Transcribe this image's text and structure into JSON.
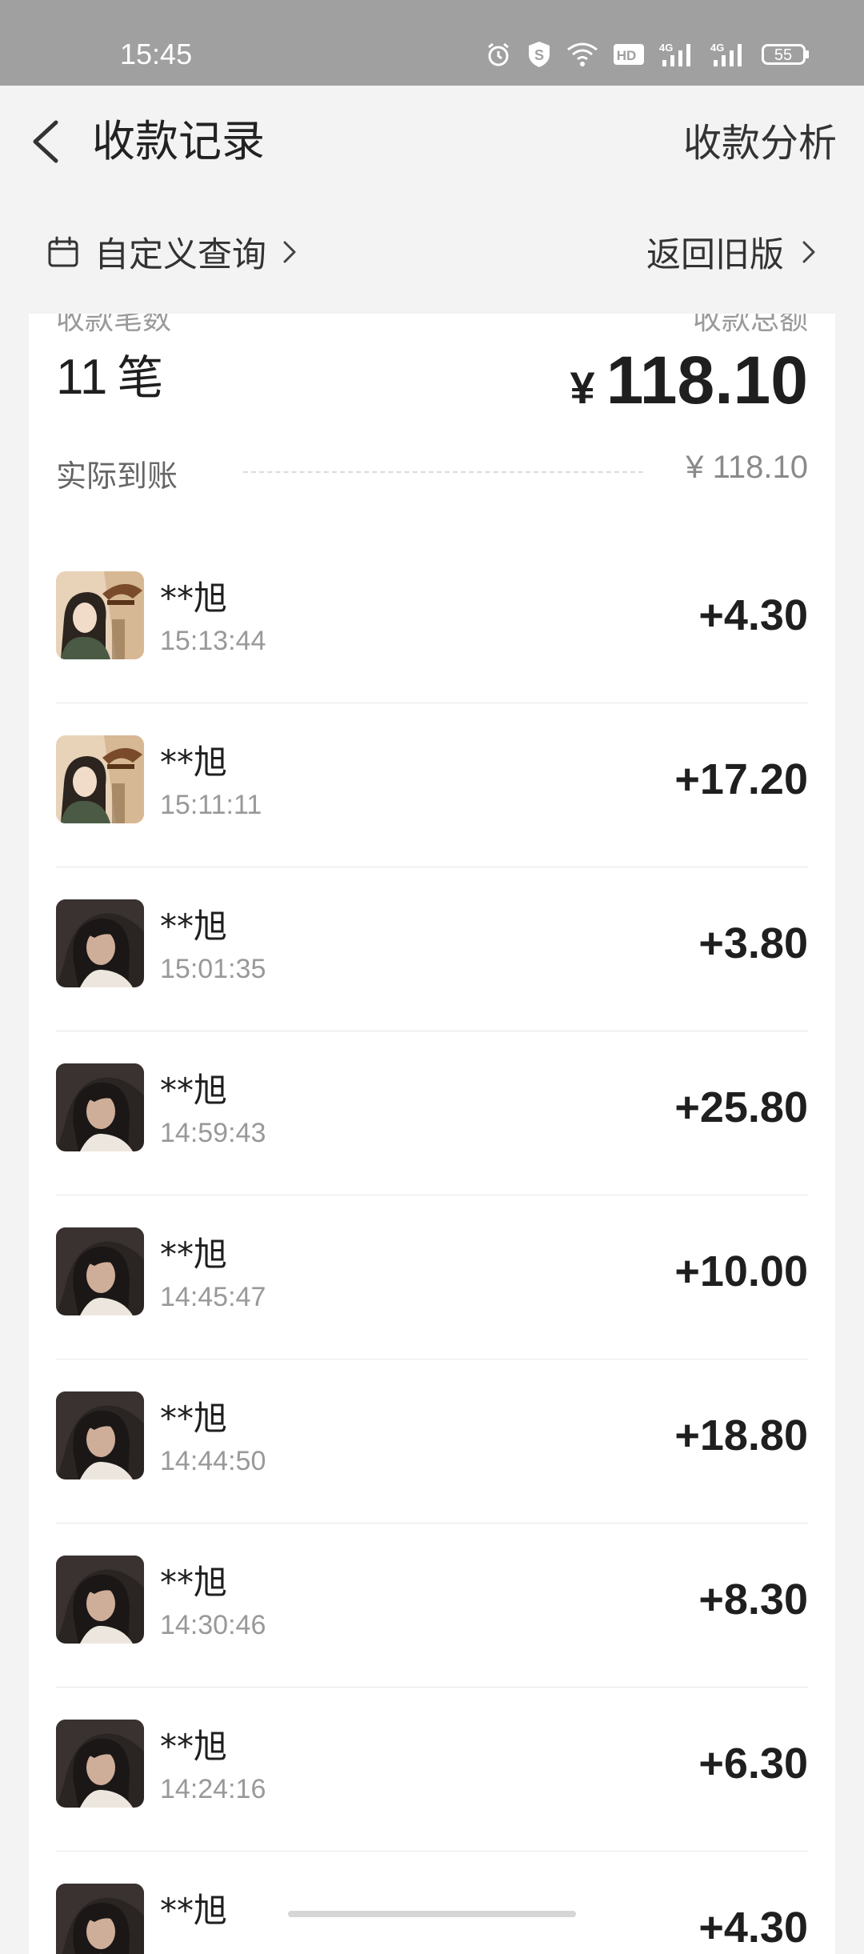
{
  "status": {
    "time": "15:45",
    "battery": "55",
    "icons": [
      "alarm-icon",
      "shield-icon",
      "wifi-icon",
      "hd-icon",
      "signal-4g-icon",
      "signal-4g-icon",
      "battery-icon"
    ]
  },
  "header": {
    "title": "收款记录",
    "analysis": "收款分析",
    "back_icon": "chevron-left-icon"
  },
  "filter": {
    "custom_query": "自定义查询",
    "old_version": "返回旧版",
    "calendar_icon": "calendar-icon"
  },
  "summary": {
    "count_label": "收款笔数",
    "total_label": "收款总额",
    "count": "11",
    "count_unit": "笔",
    "currency": "¥",
    "total": "118.10",
    "actual_label": "实际到账",
    "actual_amount": "¥ 118.10"
  },
  "transactions": [
    {
      "name": "**旭",
      "time": "15:13:44",
      "amount": "+4.30",
      "avatar": "avatar-hat"
    },
    {
      "name": "**旭",
      "time": "15:11:11",
      "amount": "+17.20",
      "avatar": "avatar-hat"
    },
    {
      "name": "**旭",
      "time": "15:01:35",
      "amount": "+3.80",
      "avatar": "avatar-dark"
    },
    {
      "name": "**旭",
      "time": "14:59:43",
      "amount": "+25.80",
      "avatar": "avatar-dark"
    },
    {
      "name": "**旭",
      "time": "14:45:47",
      "amount": "+10.00",
      "avatar": "avatar-dark"
    },
    {
      "name": "**旭",
      "time": "14:44:50",
      "amount": "+18.80",
      "avatar": "avatar-dark"
    },
    {
      "name": "**旭",
      "time": "14:30:46",
      "amount": "+8.30",
      "avatar": "avatar-dark"
    },
    {
      "name": "**旭",
      "time": "14:24:16",
      "amount": "+6.30",
      "avatar": "avatar-dark"
    },
    {
      "name": "**旭",
      "time": "",
      "amount": "+4.30",
      "avatar": "avatar-dark"
    }
  ],
  "colors": {
    "statusbar": "#a0a0a0",
    "background": "#f3f3f3",
    "card": "#ffffff",
    "muted": "#999999"
  }
}
